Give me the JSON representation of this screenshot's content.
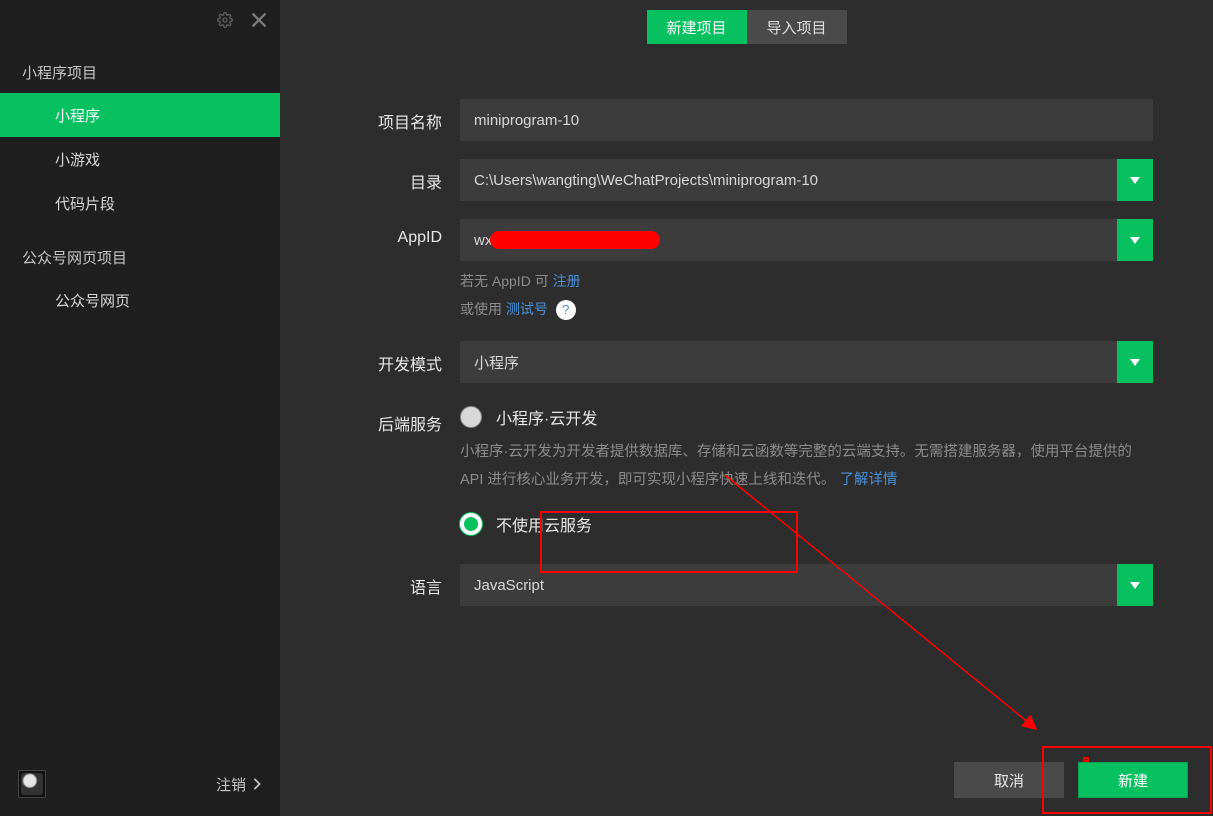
{
  "sidebar": {
    "groups": [
      {
        "title": "小程序项目",
        "items": [
          {
            "label": "小程序",
            "active": true
          },
          {
            "label": "小游戏",
            "active": false
          },
          {
            "label": "代码片段",
            "active": false
          }
        ]
      },
      {
        "title": "公众号网页项目",
        "items": [
          {
            "label": "公众号网页",
            "active": false
          }
        ]
      }
    ],
    "logout_label": "注销"
  },
  "tabs": {
    "new_project": "新建项目",
    "import_project": "导入项目"
  },
  "form": {
    "project_name_label": "项目名称",
    "project_name_value": "miniprogram-10",
    "directory_label": "目录",
    "directory_value": "C:\\Users\\wangting\\WeChatProjects\\miniprogram-10",
    "appid_label": "AppID",
    "appid_value_prefix": "wx",
    "appid_hint_prefix": "若无 AppID 可 ",
    "appid_register_link": "注册",
    "appid_hint2_prefix": "或使用 ",
    "appid_test_link": "测试号",
    "dev_mode_label": "开发模式",
    "dev_mode_value": "小程序",
    "backend_label": "后端服务",
    "backend_option_cloud": "小程序·云开发",
    "backend_desc": "小程序·云开发为开发者提供数据库、存储和云函数等完整的云端支持。无需搭建服务器，使用平台提供的 API 进行核心业务开发，即可实现小程序快速上线和迭代。 ",
    "backend_more_link": "了解详情",
    "backend_option_nocloud": "不使用云服务",
    "language_label": "语言",
    "language_value": "JavaScript"
  },
  "footer": {
    "cancel": "取消",
    "create": "新建"
  }
}
